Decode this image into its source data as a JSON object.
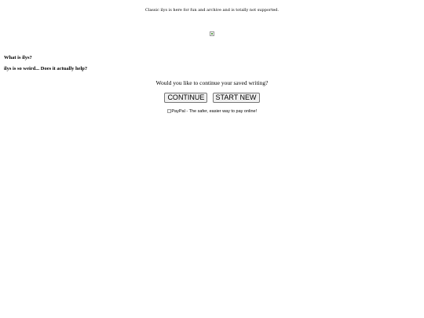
{
  "header": {
    "notice": "Classic ilys is here for fun and archive and is totally not supported."
  },
  "logo": {
    "icon": "broken-image-icon"
  },
  "faq": {
    "items": [
      {
        "label": "What is ilys?"
      },
      {
        "label": "ilys is so weird... Does it actually help?"
      }
    ]
  },
  "resume": {
    "prompt": "Would you like to continue your saved writing?",
    "continue_label": "CONTINUE",
    "start_new_label": "START NEW"
  },
  "donate": {
    "alt_text": "PayPal - The safer, easier way to pay online!",
    "icon": "broken-image-icon"
  }
}
